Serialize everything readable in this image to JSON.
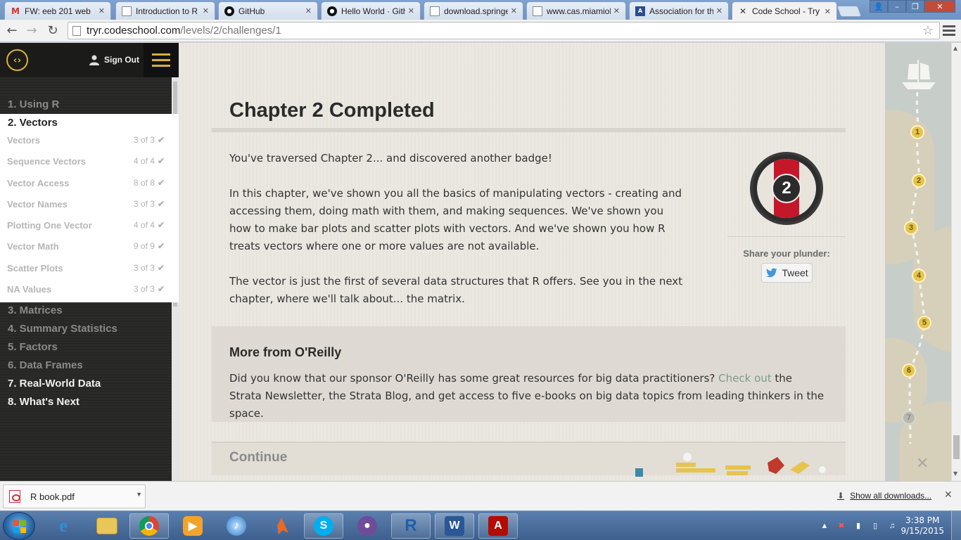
{
  "browser": {
    "tabs": [
      {
        "label": "FW: eeb 201 web",
        "icon": "gmail-icon",
        "active": false
      },
      {
        "label": "Introduction to R",
        "icon": "page-icon",
        "active": false
      },
      {
        "label": "GitHub",
        "icon": "github-icon",
        "active": false
      },
      {
        "label": "Hello World · Gith",
        "icon": "github-icon",
        "active": false
      },
      {
        "label": "download.springe",
        "icon": "page-icon",
        "active": false
      },
      {
        "label": "www.cas.miamioh",
        "icon": "page-icon",
        "active": false
      },
      {
        "label": "Association for th",
        "icon": "site-icon",
        "active": false
      },
      {
        "label": "Code School - Try",
        "icon": "codeschool-icon",
        "active": true
      }
    ],
    "url_host": "tryr.codeschool.com",
    "url_path": "/levels/2/challenges/1"
  },
  "sidebar": {
    "sign_out_label": "Sign Out",
    "chapters_before": [
      {
        "label": "1. Using R"
      }
    ],
    "active_chapter": {
      "label": "2. Vectors",
      "challenges": [
        {
          "name": "Vectors",
          "count": "3 of 3"
        },
        {
          "name": "Sequence Vectors",
          "count": "4 of 4"
        },
        {
          "name": "Vector Access",
          "count": "8 of 8"
        },
        {
          "name": "Vector Names",
          "count": "3 of 3"
        },
        {
          "name": "Plotting One Vector",
          "count": "4 of 4"
        },
        {
          "name": "Vector Math",
          "count": "9 of 9"
        },
        {
          "name": "Scatter Plots",
          "count": "3 of 3"
        },
        {
          "name": "NA Values",
          "count": "3 of 3"
        }
      ]
    },
    "chapters_after": [
      {
        "label": "3. Matrices",
        "bright": false
      },
      {
        "label": "4. Summary Statistics",
        "bright": false
      },
      {
        "label": "5. Factors",
        "bright": false
      },
      {
        "label": "6. Data Frames",
        "bright": false
      },
      {
        "label": "7. Real-World Data",
        "bright": true
      },
      {
        "label": "8. What's Next",
        "bright": true
      }
    ]
  },
  "main": {
    "title": "Chapter 2 Completed",
    "paragraphs": [
      "You've traversed Chapter 2... and discovered another badge!",
      "In this chapter, we've shown you all the basics of manipulating vectors - creating and accessing them, doing math with them, and making sequences. We've shown you how to make bar plots and scatter plots with vectors. And we've shown you how R treats vectors where one or more values are not available.",
      "The vector is just the first of several data structures that R offers. See you in the next chapter, where we'll talk about... the matrix."
    ],
    "badge_number": "2",
    "share_label": "Share your plunder:",
    "tweet_label": "Tweet",
    "oreilly": {
      "title": "More from O'Reilly",
      "text_before": "Did you know that our sponsor O'Reilly has some great resources for big data practitioners? ",
      "link_text": "Check out",
      "text_after": " the Strata Newsletter, the Strata Blog, and get access to five e-books on big data topics from leading thinkers in the space."
    },
    "continue_label": "Continue"
  },
  "map": {
    "waypoints": [
      "1",
      "2",
      "3",
      "4",
      "5",
      "6",
      "7"
    ]
  },
  "downloads": {
    "file_name": "R book.pdf",
    "show_all_label": "Show all downloads..."
  },
  "taskbar": {
    "apps": [
      {
        "name": "internet-explorer",
        "icon": "ie-icon",
        "open": false
      },
      {
        "name": "file-explorer",
        "icon": "folder-icon",
        "open": false
      },
      {
        "name": "chrome",
        "icon": "chrome-icon",
        "open": true
      },
      {
        "name": "media-player",
        "icon": "media-icon",
        "open": false
      },
      {
        "name": "itunes",
        "icon": "itunes-icon",
        "open": false
      },
      {
        "name": "matlab",
        "icon": "matlab-icon",
        "open": false
      },
      {
        "name": "skype",
        "icon": "skype-icon",
        "open": true
      },
      {
        "name": "github",
        "icon": "github-icon",
        "open": false
      },
      {
        "name": "r-gui",
        "icon": "r-icon",
        "open": true
      },
      {
        "name": "word",
        "icon": "word-icon",
        "open": true
      },
      {
        "name": "acrobat",
        "icon": "acrobat-icon",
        "open": true
      }
    ],
    "clock_time": "3:38 PM",
    "clock_date": "9/15/2015"
  },
  "colors": {
    "accent_gold": "#d8b03a",
    "badge_red": "#c4172a",
    "link_green": "#7f9a8a"
  }
}
